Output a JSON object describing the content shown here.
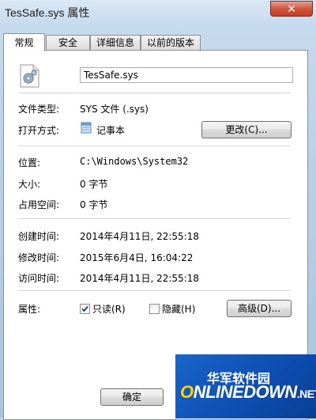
{
  "window": {
    "title": "TesSafe.sys 属性",
    "close_glyph": "✕"
  },
  "tabs": [
    "常规",
    "安全",
    "详细信息",
    "以前的版本"
  ],
  "general": {
    "file_name": "TesSafe.sys",
    "type_label": "文件类型:",
    "type_value": "SYS 文件 (.sys)",
    "opens_with_label": "打开方式:",
    "opens_with_value": "记事本",
    "change_button": "更改(C)...",
    "location_label": "位置:",
    "location_value": "C:\\Windows\\System32",
    "size_label": "大小:",
    "size_value": "0 字节",
    "size_on_disk_label": "占用空间:",
    "size_on_disk_value": "0 字节",
    "created_label": "创建时间:",
    "created_value": "2014年4月11日, 22:55:18",
    "modified_label": "修改时间:",
    "modified_value": "2015年6月4日, 16:04:22",
    "accessed_label": "访问时间:",
    "accessed_value": "2014年4月11日, 22:55:18",
    "attributes_label": "属性:",
    "readonly_label": "只读(R)",
    "readonly_checked": true,
    "hidden_label": "隐藏(H)",
    "hidden_checked": false,
    "advanced_button": "高级(D)..."
  },
  "footer": {
    "ok_button": "确定"
  },
  "watermark": {
    "brand_cn": "华军软件园",
    "brand_en_prefix": "",
    "brand_en_o": "O",
    "brand_en_rest": "NLINEDOWN",
    "brand_en_tld": ".NET"
  },
  "colors": {
    "accent": "#1a65c9",
    "close": "#c53e25"
  }
}
